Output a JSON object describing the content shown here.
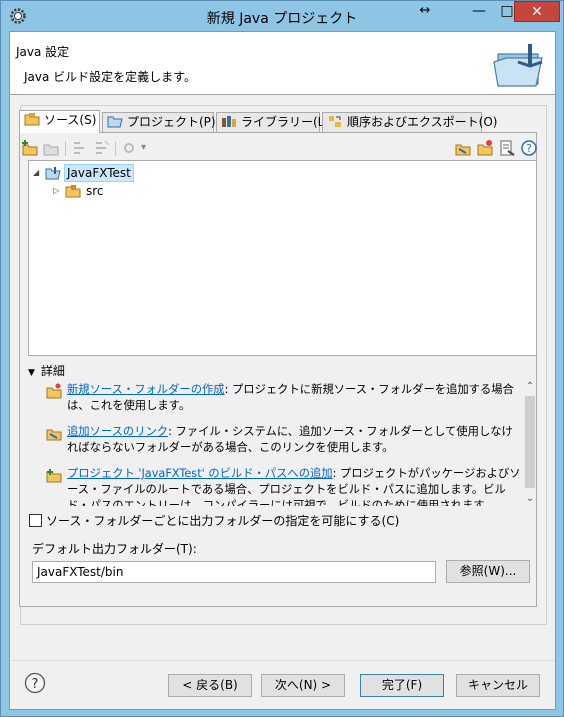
{
  "window": {
    "title": "新規 Java プロジェクト",
    "restore_glyph": "↔",
    "minimize_glyph": "—",
    "maximize_glyph": "□",
    "close_glyph": "✕"
  },
  "header": {
    "title": "Java 設定",
    "description": "Java ビルド設定を定義します。"
  },
  "tabs": [
    {
      "label": "ソース(S)",
      "active": true
    },
    {
      "label": "プロジェクト(P)",
      "active": false
    },
    {
      "label": "ライブラリー(L)",
      "active": false
    },
    {
      "label": "順序およびエクスポート(O)",
      "active": false
    }
  ],
  "toolbar": {
    "help_glyph": "?",
    "dropdown_glyph": "▾"
  },
  "tree": {
    "project": {
      "label": "JavaFXTest",
      "toggle": "◢"
    },
    "src": {
      "label": "src",
      "toggle": "▷"
    }
  },
  "details": {
    "heading": "詳細",
    "arrow": "▼",
    "items": [
      {
        "link": "新規ソース・フォルダーの作成",
        "text": ": プロジェクトに新規ソース・フォルダーを追加する場合は、これを使用します。"
      },
      {
        "link": "追加ソースのリンク",
        "text": ": ファイル・システムに、追加ソース・フォルダーとして使用しなければならないフォルダーがある場合、このリンクを使用します。"
      },
      {
        "link": "プロジェクト 'JavaFXTest' のビルド・パスへの追加",
        "text": ": プロジェクトがパッケージおよびソース・ファイルのルートである場合、プロジェクトをビルド・パスに追加します。ビルド・パスのエントリーは、コンパイラーには可視で、ビルドのために使用されます。"
      }
    ],
    "scroll_up": "⌃",
    "scroll_down": "⌄"
  },
  "checkbox": {
    "label": "ソース・フォルダーごとに出力フォルダーの指定を可能にする(C)",
    "checked": false
  },
  "output": {
    "label": "デフォルト出力フォルダー(T):",
    "value": "JavaFXTest/bin",
    "browse_label": "参照(W)..."
  },
  "footer": {
    "help_glyph": "?",
    "back_label": "< 戻る(B)",
    "next_label": "次へ(N) >",
    "finish_label": "完了(F)",
    "cancel_label": "キャンセル"
  },
  "colors": {
    "frame": "#8ec4e4",
    "close": "#c7463c",
    "link": "#0066cc",
    "selection": "#cce8ff"
  }
}
